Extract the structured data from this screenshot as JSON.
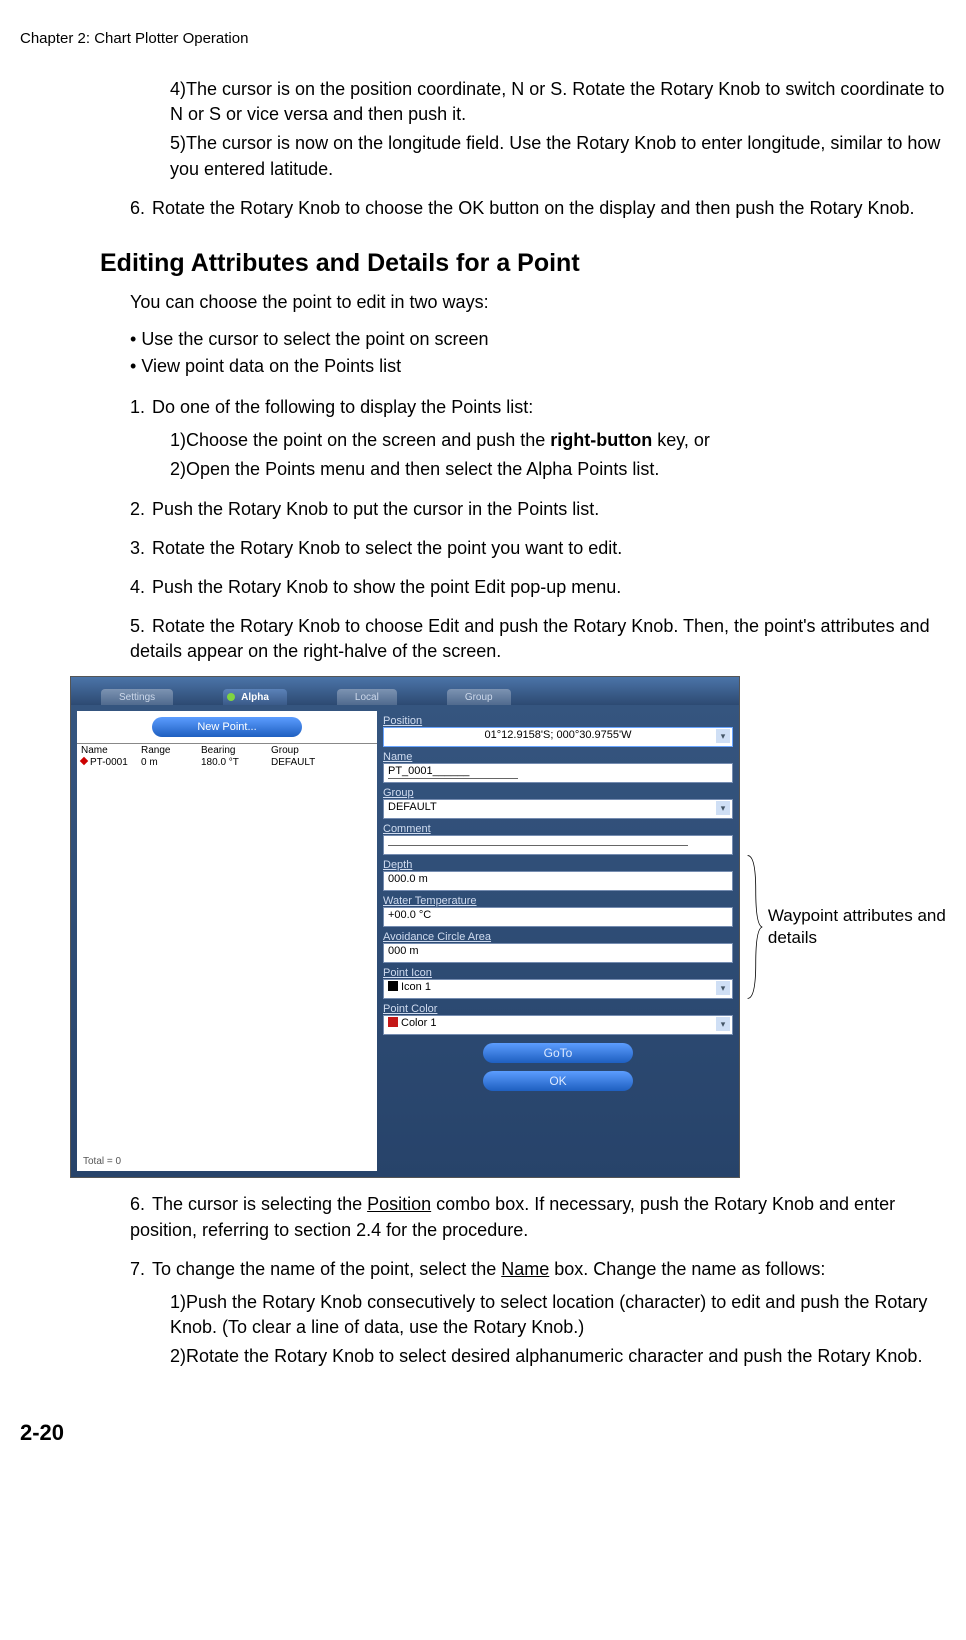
{
  "header": "Chapter 2: Chart Plotter Operation",
  "intro_steps_a": [
    "The cursor is on the position coordinate, N or S. Rotate the Rotary Knob to switch coordinate to N or S or vice versa and then push it.",
    "The cursor is now on the longitude field. Use the Rotary Knob to enter longitude, similar to how you entered latitude."
  ],
  "step6_top": "Rotate the Rotary Knob to choose the OK button on the display and then push the Rotary Knob.",
  "heading": "Editing Attributes and Details for a Point",
  "intro": "You can choose the point to edit in two ways:",
  "bullets": [
    "Use the cursor to select the point on screen",
    "View point data on the Points list"
  ],
  "steps_main": {
    "1": {
      "text": "Do one of the following to display the Points list:",
      "subs": {
        "1_pre": "Choose the point on the screen and push the ",
        "1_bold": "right-button",
        "1_post": " key, or",
        "2": "Open the Points menu and then select the Alpha Points list."
      }
    },
    "2": "Push the Rotary Knob to put the cursor in the Points list.",
    "3": "Rotate the Rotary Knob to select the point you want to edit.",
    "4": "Push the Rotary Knob to show the point Edit pop-up menu.",
    "5": "Rotate the Rotary Knob to choose Edit and push the Rotary Knob. Then, the point's attributes and details appear on the right-halve of the screen."
  },
  "screenshot": {
    "tabs": {
      "settings": "Settings",
      "alpha": "Alpha",
      "local": "Local",
      "group": "Group"
    },
    "new_point": "New Point...",
    "cols": {
      "name": "Name",
      "range": "Range",
      "bearing": "Bearing",
      "group": "Group"
    },
    "row": {
      "name": "PT-0001",
      "range": "0 m",
      "bearing": "180.0 °T",
      "group": "DEFAULT"
    },
    "total": "Total = 0",
    "fields": {
      "position_label": "Position",
      "position_value": "01°12.9158'S; 000°30.9755'W",
      "name_label": "Name",
      "name_value": "PT_0001",
      "group_label": "Group",
      "group_value": "DEFAULT",
      "comment_label": "Comment",
      "comment_value": "",
      "depth_label": "Depth",
      "depth_value": "000.0 m",
      "watertemp_label": "Water Temperature",
      "watertemp_value": "+00.0 °C",
      "avoidance_label": "Avoidance Circle Area",
      "avoidance_value": "000 m",
      "pointicon_label": "Point Icon",
      "pointicon_value": "Icon 1",
      "pointcolor_label": "Point Color",
      "pointcolor_value": "Color 1",
      "goto": "GoTo",
      "ok": "OK"
    }
  },
  "annotation": "Waypoint attributes and details",
  "steps_after": {
    "6_pre": "The cursor is selecting the ",
    "6_u": "Position",
    "6_post": " combo box. If necessary, push the Rotary Knob and enter position, referring to section 2.4 for the procedure.",
    "7_pre": "To change the name of the point, select the ",
    "7_u": "Name",
    "7_post": " box. Change the name as follows:",
    "7_subs": {
      "1": "Push the Rotary Knob consecutively to select location (character) to edit and push the Rotary Knob. (To clear a line of data, use the Rotary Knob.)",
      "2": "Rotate the Rotary Knob to select desired alphanumeric character and push the Rotary Knob."
    }
  },
  "page_number": "2-20"
}
